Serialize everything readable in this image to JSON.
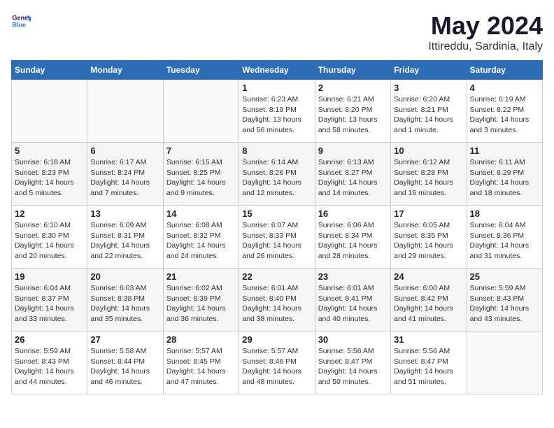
{
  "header": {
    "logo": "GeneralBlue",
    "month": "May 2024",
    "location": "Ittireddu, Sardinia, Italy"
  },
  "weekdays": [
    "Sunday",
    "Monday",
    "Tuesday",
    "Wednesday",
    "Thursday",
    "Friday",
    "Saturday"
  ],
  "weeks": [
    [
      {
        "day": "",
        "info": ""
      },
      {
        "day": "",
        "info": ""
      },
      {
        "day": "",
        "info": ""
      },
      {
        "day": "1",
        "info": "Sunrise: 6:23 AM\nSunset: 8:19 PM\nDaylight: 13 hours and 56 minutes."
      },
      {
        "day": "2",
        "info": "Sunrise: 6:21 AM\nSunset: 8:20 PM\nDaylight: 13 hours and 58 minutes."
      },
      {
        "day": "3",
        "info": "Sunrise: 6:20 AM\nSunset: 8:21 PM\nDaylight: 14 hours and 1 minute."
      },
      {
        "day": "4",
        "info": "Sunrise: 6:19 AM\nSunset: 8:22 PM\nDaylight: 14 hours and 3 minutes."
      }
    ],
    [
      {
        "day": "5",
        "info": "Sunrise: 6:18 AM\nSunset: 8:23 PM\nDaylight: 14 hours and 5 minutes."
      },
      {
        "day": "6",
        "info": "Sunrise: 6:17 AM\nSunset: 8:24 PM\nDaylight: 14 hours and 7 minutes."
      },
      {
        "day": "7",
        "info": "Sunrise: 6:15 AM\nSunset: 8:25 PM\nDaylight: 14 hours and 9 minutes."
      },
      {
        "day": "8",
        "info": "Sunrise: 6:14 AM\nSunset: 8:26 PM\nDaylight: 14 hours and 12 minutes."
      },
      {
        "day": "9",
        "info": "Sunrise: 6:13 AM\nSunset: 8:27 PM\nDaylight: 14 hours and 14 minutes."
      },
      {
        "day": "10",
        "info": "Sunrise: 6:12 AM\nSunset: 8:28 PM\nDaylight: 14 hours and 16 minutes."
      },
      {
        "day": "11",
        "info": "Sunrise: 6:11 AM\nSunset: 8:29 PM\nDaylight: 14 hours and 18 minutes."
      }
    ],
    [
      {
        "day": "12",
        "info": "Sunrise: 6:10 AM\nSunset: 8:30 PM\nDaylight: 14 hours and 20 minutes."
      },
      {
        "day": "13",
        "info": "Sunrise: 6:09 AM\nSunset: 8:31 PM\nDaylight: 14 hours and 22 minutes."
      },
      {
        "day": "14",
        "info": "Sunrise: 6:08 AM\nSunset: 8:32 PM\nDaylight: 14 hours and 24 minutes."
      },
      {
        "day": "15",
        "info": "Sunrise: 6:07 AM\nSunset: 8:33 PM\nDaylight: 14 hours and 26 minutes."
      },
      {
        "day": "16",
        "info": "Sunrise: 6:06 AM\nSunset: 8:34 PM\nDaylight: 14 hours and 28 minutes."
      },
      {
        "day": "17",
        "info": "Sunrise: 6:05 AM\nSunset: 8:35 PM\nDaylight: 14 hours and 29 minutes."
      },
      {
        "day": "18",
        "info": "Sunrise: 6:04 AM\nSunset: 8:36 PM\nDaylight: 14 hours and 31 minutes."
      }
    ],
    [
      {
        "day": "19",
        "info": "Sunrise: 6:04 AM\nSunset: 8:37 PM\nDaylight: 14 hours and 33 minutes."
      },
      {
        "day": "20",
        "info": "Sunrise: 6:03 AM\nSunset: 8:38 PM\nDaylight: 14 hours and 35 minutes."
      },
      {
        "day": "21",
        "info": "Sunrise: 6:02 AM\nSunset: 8:39 PM\nDaylight: 14 hours and 36 minutes."
      },
      {
        "day": "22",
        "info": "Sunrise: 6:01 AM\nSunset: 8:40 PM\nDaylight: 14 hours and 38 minutes."
      },
      {
        "day": "23",
        "info": "Sunrise: 6:01 AM\nSunset: 8:41 PM\nDaylight: 14 hours and 40 minutes."
      },
      {
        "day": "24",
        "info": "Sunrise: 6:00 AM\nSunset: 8:42 PM\nDaylight: 14 hours and 41 minutes."
      },
      {
        "day": "25",
        "info": "Sunrise: 5:59 AM\nSunset: 8:43 PM\nDaylight: 14 hours and 43 minutes."
      }
    ],
    [
      {
        "day": "26",
        "info": "Sunrise: 5:59 AM\nSunset: 8:43 PM\nDaylight: 14 hours and 44 minutes."
      },
      {
        "day": "27",
        "info": "Sunrise: 5:58 AM\nSunset: 8:44 PM\nDaylight: 14 hours and 46 minutes."
      },
      {
        "day": "28",
        "info": "Sunrise: 5:57 AM\nSunset: 8:45 PM\nDaylight: 14 hours and 47 minutes."
      },
      {
        "day": "29",
        "info": "Sunrise: 5:57 AM\nSunset: 8:46 PM\nDaylight: 14 hours and 48 minutes."
      },
      {
        "day": "30",
        "info": "Sunrise: 5:56 AM\nSunset: 8:47 PM\nDaylight: 14 hours and 50 minutes."
      },
      {
        "day": "31",
        "info": "Sunrise: 5:56 AM\nSunset: 8:47 PM\nDaylight: 14 hours and 51 minutes."
      },
      {
        "day": "",
        "info": ""
      }
    ]
  ]
}
